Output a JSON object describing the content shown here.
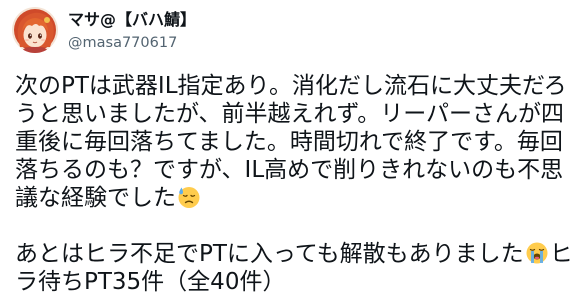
{
  "user": {
    "display_name": "マサ@【バハ鯖】",
    "handle": "@masa770617",
    "avatar_icon": "avatar-image"
  },
  "tweet": {
    "lines": [
      {
        "text": "次のPTは武器IL指定あり。消化だし流石に大丈夫だろ"
      },
      {
        "text": "うと思いましたが、前半越えれず。リーパーさんが四"
      },
      {
        "text": "重後に毎回落ちてました。時間切れで終了です。毎回"
      },
      {
        "text": "落ちるのも？ですが、IL高めで削りきれないのも不思"
      },
      {
        "text": "議な経験でした",
        "emoji": "downcast-face-with-sweat-icon"
      },
      {
        "text": "あとはヒラ不足でPTに入っても解散もありました",
        "emoji": "loudly-crying-face-icon",
        "text_after": "ヒ"
      },
      {
        "text": "ラ待ちPT35件（全40件）"
      }
    ]
  },
  "colors": {
    "text": "#0f1419",
    "secondary_text": "#536471",
    "background": "#ffffff"
  }
}
